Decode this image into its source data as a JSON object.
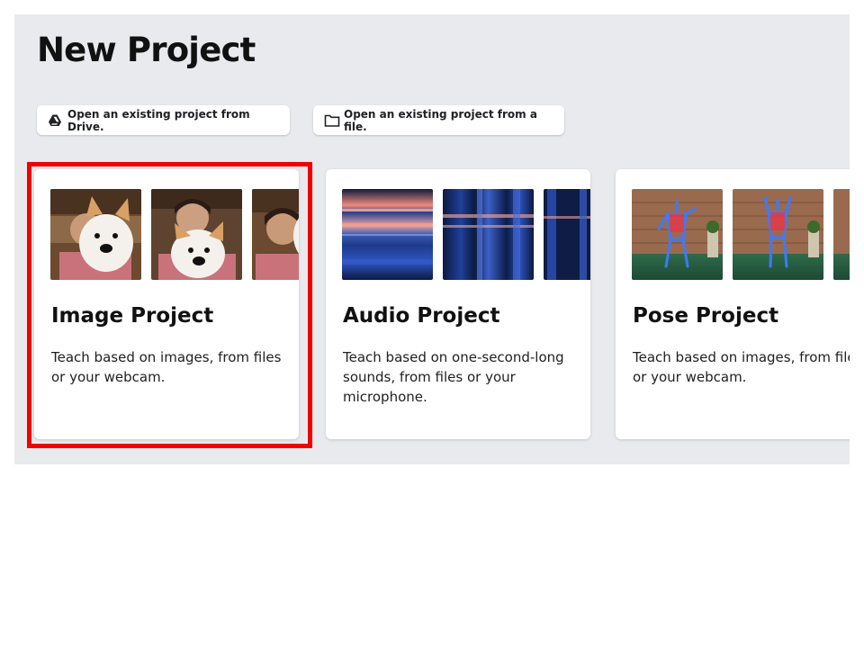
{
  "header": {
    "title": "New Project"
  },
  "open_options": {
    "drive_label": "Open an existing project from Drive.",
    "file_label": "Open an existing project from a file."
  },
  "projects": [
    {
      "title": "Image Project",
      "description": "Teach based on images, from files or your webcam.",
      "icon": "image-thumbnails",
      "selected": true
    },
    {
      "title": "Audio Project",
      "description": "Teach based on one-second-long sounds, from files or your microphone.",
      "icon": "spectrogram-thumbnails",
      "selected": false
    },
    {
      "title": "Pose Project",
      "description": "Teach based on images, from files or your webcam.",
      "icon": "pose-thumbnails",
      "selected": false
    }
  ],
  "highlight_color": "#f20000",
  "background_color": "#e8eaed"
}
